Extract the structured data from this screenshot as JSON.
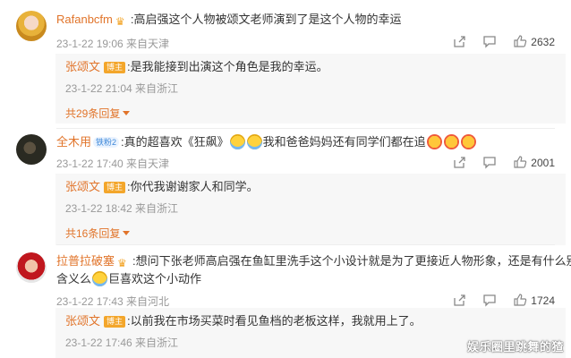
{
  "comments": [
    {
      "user": "Rafanbcfm",
      "text": ":高启强这个人物被颂文老师演到了是这个人物的幸运",
      "meta": "23-1-22 19:06 来自天津",
      "likes": "2632",
      "reply": {
        "user": "张颂文",
        "badge": "博主",
        "text": ":是我能接到出演这个角色是我的幸运。",
        "meta": "23-1-22 21:04 来自浙江"
      },
      "more": "共29条回复"
    },
    {
      "user": "全木用",
      "vip": "铁粉2",
      "text_before": ":真的超喜欢《狂飙》",
      "text_middle": "我和爸爸妈妈还有同学们都在追",
      "meta": "23-1-22 17:40 来自天津",
      "likes": "2001",
      "reply": {
        "user": "张颂文",
        "badge": "博主",
        "text": ":你代我谢谢家人和同学。",
        "meta": "23-1-22 18:42 来自浙江"
      },
      "more": "共16条回复"
    },
    {
      "user": "拉普拉破塞",
      "text_line1": ":想问下张老师高启强在鱼缸里洗手这个小设计就是为了更接近人物形象，还是有什么别的",
      "text_line2_before": "含义么",
      "text_line2_after": "巨喜欢这个小动作",
      "meta": "23-1-22 17:43 来自河北",
      "likes": "1724",
      "reply": {
        "user": "张颂文",
        "badge": "博主",
        "text": ":以前我在市场买菜时看见鱼档的老板这样，我就用上了。",
        "meta": "23-1-22 17:46 来自浙江"
      }
    }
  ],
  "watermark": "娱乐圈里跳舞的猹",
  "icons": {
    "share": "share-icon",
    "comment": "comment-icon",
    "like": "like-icon",
    "badge": "crown-badge-icon"
  },
  "colors": {
    "username": "#e1742a",
    "meta": "#999999",
    "badge": "#f3a62b"
  }
}
